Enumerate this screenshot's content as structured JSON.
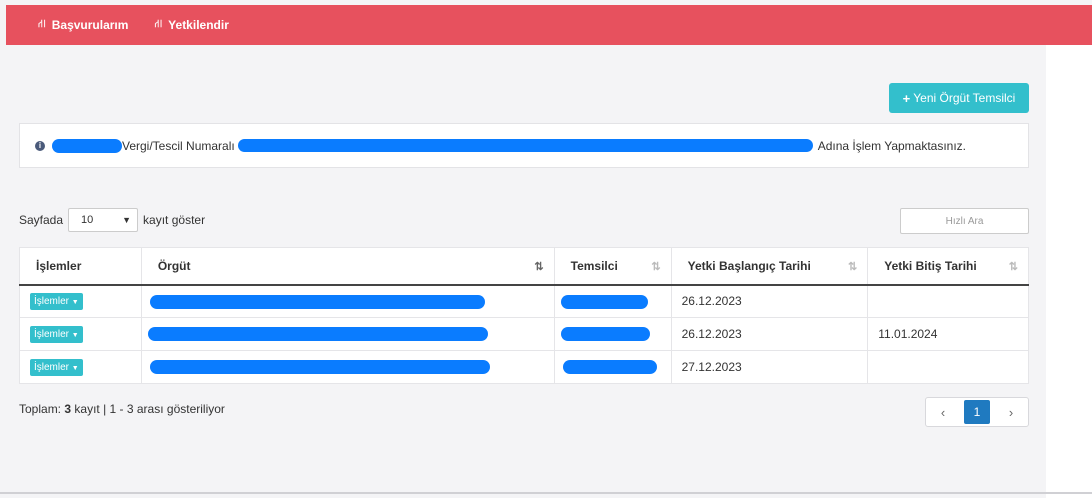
{
  "nav": {
    "items": [
      {
        "label": "Başvurularım",
        "icon": "signpost-icon"
      },
      {
        "label": "Yetkilendir",
        "icon": "signpost-icon"
      }
    ]
  },
  "toolbar": {
    "new_button_label": "Yeni Örgüt Temsilci"
  },
  "info": {
    "text_middle": "Vergi/Tescil Numaralı",
    "text_end": "Adına İşlem Yapmaktasınız."
  },
  "length": {
    "prefix": "Sayfada",
    "value": "10",
    "suffix": "kayıt göster"
  },
  "search": {
    "placeholder": "Hızlı Ara"
  },
  "table": {
    "headers": [
      "İşlemler",
      "Örgüt",
      "Temsilci",
      "Yetki Başlangıç Tarihi",
      "Yetki Bitiş Tarihi"
    ],
    "ops_label": "İşlemler",
    "rows": [
      {
        "start": "26.12.2023",
        "end": ""
      },
      {
        "start": "26.12.2023",
        "end": "11.01.2024"
      },
      {
        "start": "27.12.2023",
        "end": ""
      }
    ]
  },
  "summary": {
    "prefix": "Toplam:",
    "count": "3",
    "rest": "kayıt | 1 - 3 arası gösteriliyor"
  },
  "pagination": {
    "prev": "‹",
    "current": "1",
    "next": "›"
  },
  "colors": {
    "topbar": "#e7515e",
    "accent": "#33bfcc",
    "redaction": "#0a7cff",
    "page_active": "#1f7ac0"
  }
}
